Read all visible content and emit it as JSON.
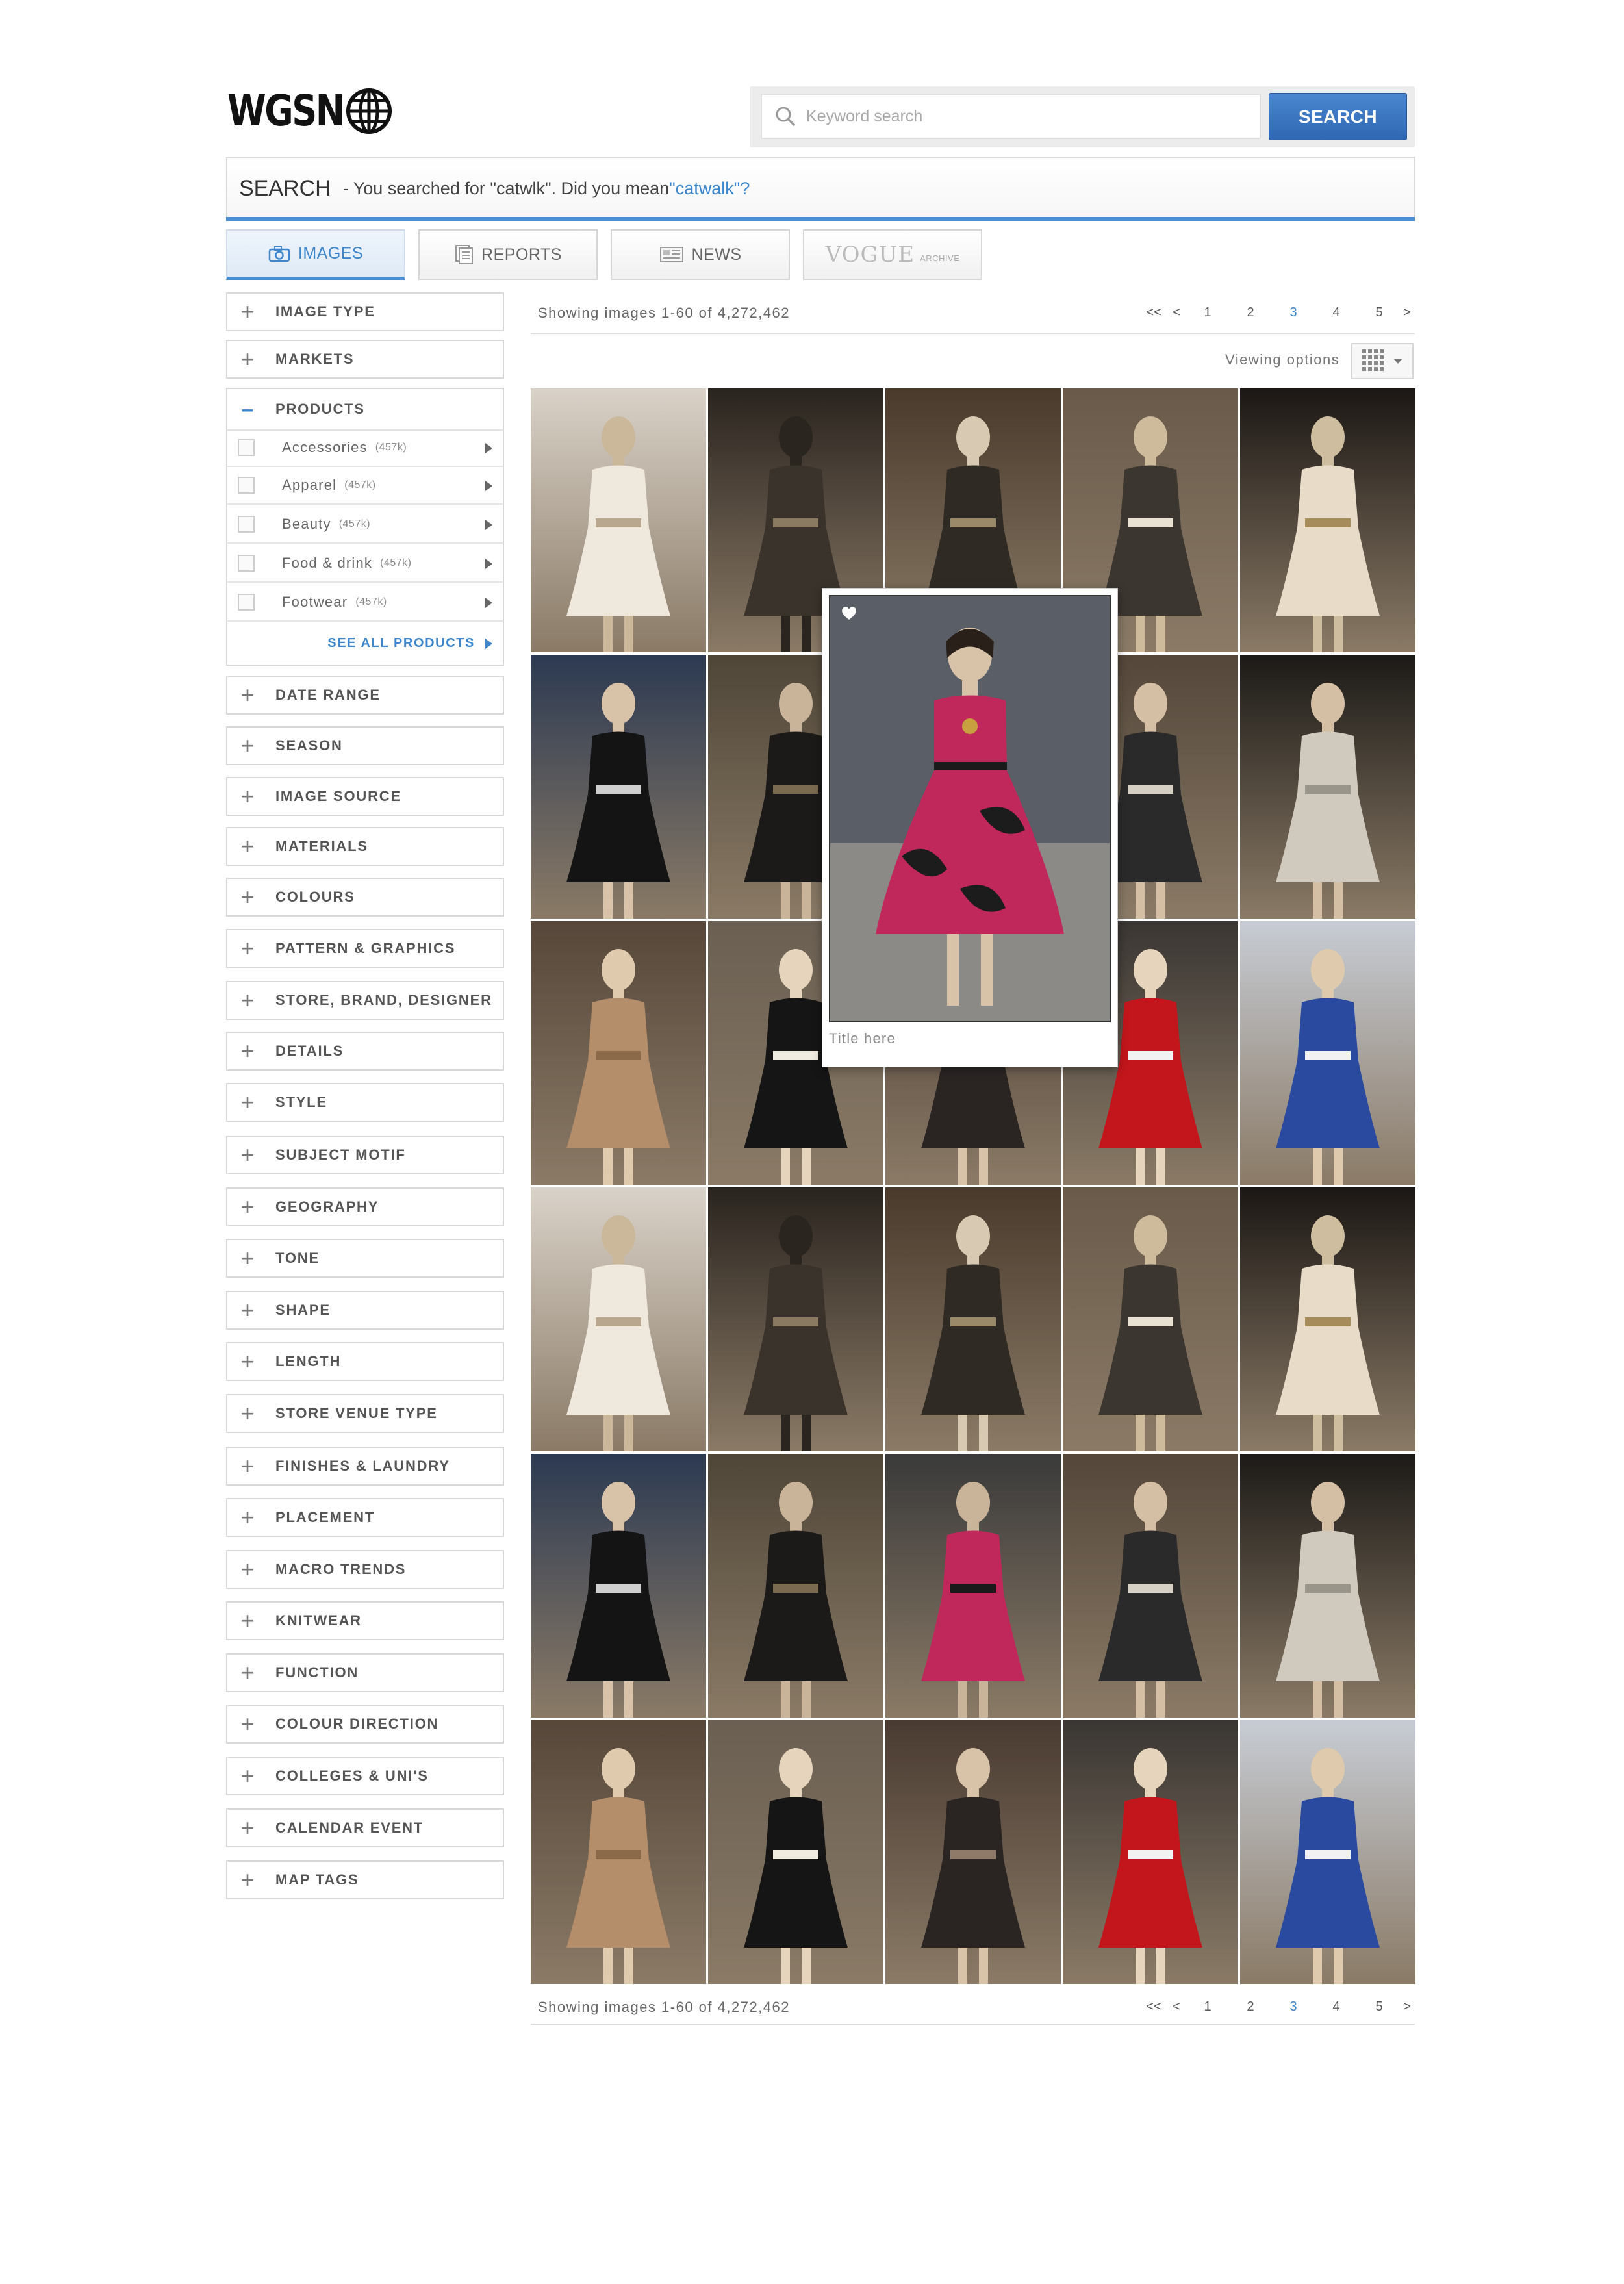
{
  "header": {
    "logo_text": "WGSN",
    "search": {
      "placeholder": "Keyword search",
      "button_label": "SEARCH"
    }
  },
  "search_bar": {
    "title": "SEARCH",
    "message": " - You searched for \"catwlk\". Did you mean ",
    "suggestion": "\"catwalk\"?"
  },
  "tabs": [
    {
      "label": "IMAGES",
      "icon": "camera-icon",
      "active": true
    },
    {
      "label": "REPORTS",
      "icon": "reports-icon"
    },
    {
      "label": "NEWS",
      "icon": "news-icon"
    },
    {
      "label": "VOGUE",
      "sublabel": "ARCHIVE"
    }
  ],
  "filters_top": [
    {
      "label": "IMAGE TYPE"
    },
    {
      "label": "MARKETS"
    }
  ],
  "products": {
    "label": "PRODUCTS",
    "items": [
      {
        "name": "Accessories",
        "count": "(457k)"
      },
      {
        "name": "Apparel",
        "count": "(457k)"
      },
      {
        "name": "Beauty",
        "count": "(457k)"
      },
      {
        "name": "Food & drink",
        "count": "(457k)"
      },
      {
        "name": "Footwear",
        "count": "(457k)"
      }
    ],
    "see_all": "SEE ALL PRODUCTS"
  },
  "filters": [
    "DATE RANGE",
    "SEASON",
    "IMAGE SOURCE",
    "MATERIALS",
    "COLOURS",
    "PATTERN & GRAPHICS",
    "STORE, BRAND, DESIGNER",
    "DETAILS",
    "STYLE",
    "SUBJECT MOTIF",
    "GEOGRAPHY",
    "TONE",
    "SHAPE",
    "LENGTH",
    "STORE VENUE TYPE",
    "FINISHES & LAUNDRY",
    "PLACEMENT",
    "MACRO TRENDS",
    "KNITWEAR",
    "FUNCTION",
    "COLOUR DIRECTION",
    "COLLEGES & UNI'S",
    "CALENDAR EVENT",
    "MAP TAGS"
  ],
  "results": {
    "count_text": "Showing images 1-60 of 4,272,462",
    "pager": {
      "first": "<<",
      "prev": "<",
      "pages": [
        "1",
        "2",
        "3",
        "4",
        "5"
      ],
      "current": "3",
      "next": ">"
    },
    "viewing_options": "Viewing options"
  },
  "popup": {
    "caption": "Title here"
  },
  "colors": {
    "accent": "#3d86cc",
    "button": "#2f67b3",
    "border": "#d8d8d8"
  }
}
